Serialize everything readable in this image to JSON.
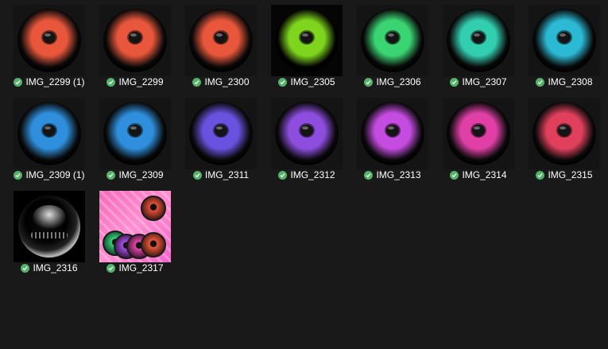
{
  "files": [
    {
      "name": "IMG_2299 (1)",
      "color": "#e8573b",
      "frame": "#141414"
    },
    {
      "name": "IMG_2299",
      "color": "#e8573b",
      "frame": "#141414"
    },
    {
      "name": "IMG_2300",
      "color": "#e8573b",
      "frame": "#141414"
    },
    {
      "name": "IMG_2305",
      "color": "#7fd51e",
      "frame": "#050505"
    },
    {
      "name": "IMG_2306",
      "color": "#3bd472",
      "frame": "#141414"
    },
    {
      "name": "IMG_2307",
      "color": "#33cdb0",
      "frame": "#141414"
    },
    {
      "name": "IMG_2308",
      "color": "#2bb9d4",
      "frame": "#141414"
    },
    {
      "name": "IMG_2309 (1)",
      "color": "#2f8fdc",
      "frame": "#141414"
    },
    {
      "name": "IMG_2309",
      "color": "#2f8fdc",
      "frame": "#141414"
    },
    {
      "name": "IMG_2311",
      "color": "#6a52e0",
      "frame": "#141414"
    },
    {
      "name": "IMG_2312",
      "color": "#8d4ee0",
      "frame": "#141414"
    },
    {
      "name": "IMG_2313",
      "color": "#c44ce0",
      "frame": "#141414"
    },
    {
      "name": "IMG_2314",
      "color": "#e040a6",
      "frame": "#141414"
    },
    {
      "name": "IMG_2315",
      "color": "#e0405c",
      "frame": "#141414"
    },
    {
      "name": "IMG_2316",
      "kind": "bw"
    },
    {
      "name": "IMG_2317",
      "kind": "promo"
    }
  ],
  "status_icon": "synced-check-icon",
  "status_color": "#56b26a"
}
